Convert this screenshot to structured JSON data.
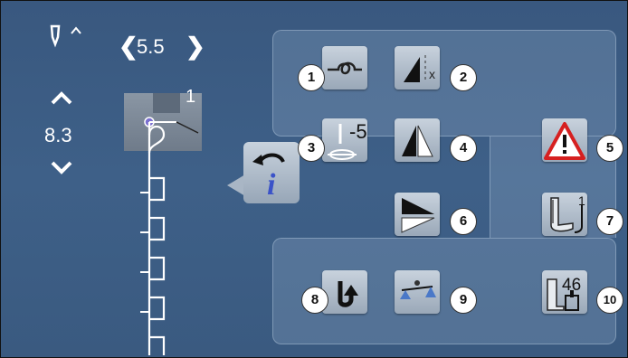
{
  "needle_position": {
    "value": "5.5"
  },
  "stitch_length": {
    "value": "8.3"
  },
  "preview": {
    "stitch_number": "1"
  },
  "functions": [
    {
      "label": "1",
      "icon": "securing-knot-icon"
    },
    {
      "label": "2",
      "icon": "pattern-repeat-icon"
    },
    {
      "label": "3",
      "icon": "long-stitch-icon",
      "value": "-5"
    },
    {
      "label": "4",
      "icon": "mirror-image-icon"
    },
    {
      "label": "5",
      "icon": "warning-icon"
    },
    {
      "label": "6",
      "icon": "pattern-end-icon"
    },
    {
      "label": "7",
      "icon": "presser-foot-indicator-icon",
      "value": "1"
    },
    {
      "label": "8",
      "icon": "reverse-sewing-icon"
    },
    {
      "label": "9",
      "icon": "balance-icon"
    },
    {
      "label": "10",
      "icon": "needle-stop-icon",
      "value": "46"
    }
  ],
  "colors": {
    "background": "#3e6088",
    "button": "#b6c1ce",
    "warning": "#d62020",
    "info": "#3a52c8"
  }
}
